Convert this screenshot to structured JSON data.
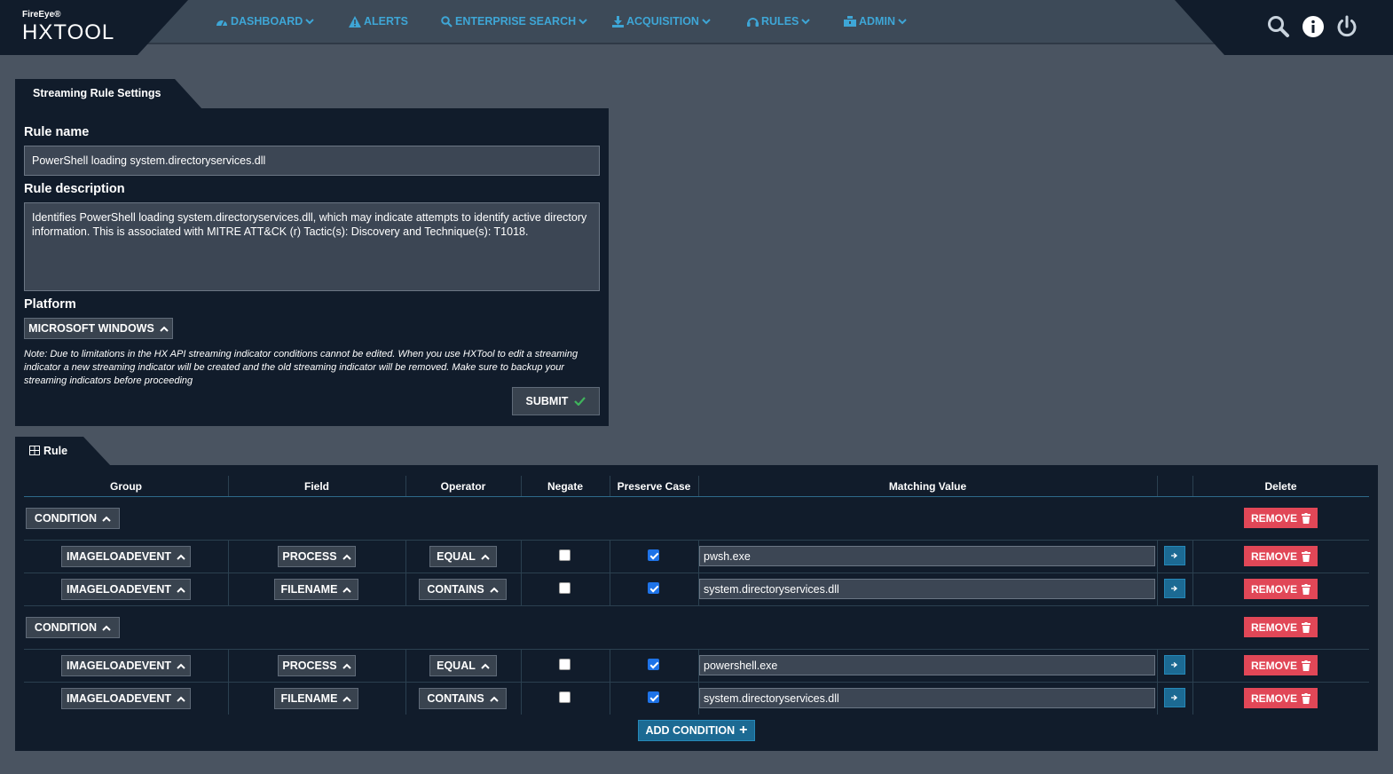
{
  "brand": {
    "small": "FireEye®",
    "name": "HXTOOL"
  },
  "nav": [
    {
      "label": "DASHBOARD",
      "icon": "dashboard-icon",
      "dropdown": true
    },
    {
      "label": "ALERTS",
      "icon": "warning-icon",
      "dropdown": false
    },
    {
      "label": "ENTERPRISE SEARCH",
      "icon": "search-icon",
      "dropdown": true
    },
    {
      "label": "ACQUISITION",
      "icon": "download-icon",
      "dropdown": true
    },
    {
      "label": "RULES",
      "icon": "headset-icon",
      "dropdown": true
    },
    {
      "label": "ADMIN",
      "icon": "admin-icon",
      "dropdown": true
    }
  ],
  "settings": {
    "tab_label": "Streaming Rule Settings",
    "rule_name_label": "Rule name",
    "rule_name_value": "PowerShell loading system.directoryservices.dll",
    "rule_description_label": "Rule description",
    "rule_description_value": "Identifies PowerShell loading system.directoryservices.dll, which may indicate attempts to identify active directory information. This is associated with MITRE ATT&CK (r) Tactic(s): Discovery and Technique(s): T1018.",
    "platform_label": "Platform",
    "platform_value": "MICROSOFT WINDOWS",
    "note": "Note: Due to limitations in the HX API streaming indicator conditions cannot be edited. When you use HXTool to edit a streaming indicator a new streaming indicator will be created and the old streaming indicator will be removed. Make sure to backup your streaming indicators before proceeding",
    "submit_label": "SUBMIT"
  },
  "rule": {
    "tab_label": "Rule",
    "headers": {
      "group": "Group",
      "field": "Field",
      "operator": "Operator",
      "negate": "Negate",
      "preserve_case": "Preserve Case",
      "matching_value": "Matching Value",
      "delete": "Delete"
    },
    "condition_label": "CONDITION",
    "remove_label": "REMOVE",
    "add_condition_label": "ADD CONDITION",
    "conditions": [
      {
        "rows": [
          {
            "group": "IMAGELOADEVENT",
            "field": "PROCESS",
            "operator": "EQUAL",
            "negate": false,
            "preserve_case": true,
            "value": "pwsh.exe"
          },
          {
            "group": "IMAGELOADEVENT",
            "field": "FILENAME",
            "operator": "CONTAINS",
            "negate": false,
            "preserve_case": true,
            "value": "system.directoryservices.dll"
          }
        ]
      },
      {
        "rows": [
          {
            "group": "IMAGELOADEVENT",
            "field": "PROCESS",
            "operator": "EQUAL",
            "negate": false,
            "preserve_case": true,
            "value": "powershell.exe"
          },
          {
            "group": "IMAGELOADEVENT",
            "field": "FILENAME",
            "operator": "CONTAINS",
            "negate": false,
            "preserve_case": true,
            "value": "system.directoryservices.dll"
          }
        ]
      }
    ]
  },
  "colors": {
    "accent": "#3ea6d6",
    "panel": "#111c2b",
    "background": "#4a5461",
    "remove": "#e14757",
    "primary_button": "#1c6a93"
  }
}
